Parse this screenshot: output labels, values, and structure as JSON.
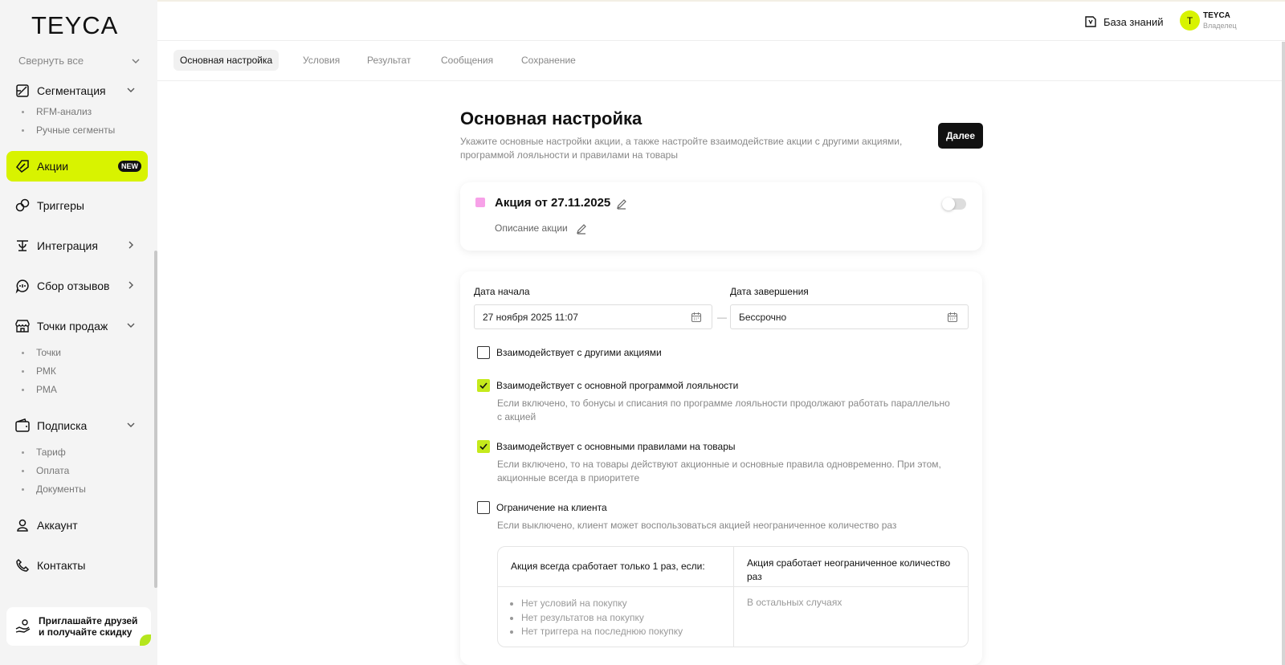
{
  "brand": {
    "logo": "TEYCA",
    "accent": "#d8f300"
  },
  "sidebar": {
    "collapse_all": "Свернуть все",
    "items": {
      "segmentation": "Сегментация",
      "rfm": "RFM-анализ",
      "manual_segments": "Ручные сегменты",
      "promotions": "Акции",
      "promotions_badge": "NEW",
      "triggers": "Триггеры",
      "integration": "Интеграция",
      "reviews": "Сбор отзывов",
      "sales_points": "Точки продаж",
      "points": "Точки",
      "rmk": "РМК",
      "rma": "РМА",
      "subscription": "Подписка",
      "tariff": "Тариф",
      "payment": "Оплата",
      "documents": "Документы",
      "account": "Аккаунт",
      "contacts": "Контакты"
    },
    "invite_line1": "Приглашайте друзей",
    "invite_line2": "и получайте скидку"
  },
  "header": {
    "knowledge_base": "База знаний",
    "user_initial": "T",
    "user_name": "TEYCA",
    "user_role": "Владелец"
  },
  "tabs": [
    "Основная настройка",
    "Условия",
    "Результат",
    "Сообщения",
    "Сохранение"
  ],
  "main": {
    "title": "Основная настройка",
    "subtitle": "Укажите основные настройки акции, а также настройте взаимодействие акции с другими акциями, программой лояльности и правилами на товары",
    "next_button": "Далее",
    "promo_name": "Акция от 27.11.2025",
    "promo_description": "Описание акции",
    "promo_color": "#f7a1e8",
    "promo_enabled": false,
    "start_label": "Дата начала",
    "start_value": "27 ноября 2025 11:07",
    "end_label": "Дата завершения",
    "end_value": "Бессрочно",
    "dash": "—",
    "options": {
      "other_promos": {
        "label": "Взаимодействует с другими акциями",
        "checked": false
      },
      "loyalty": {
        "label": "Взаимодействует с основной программой лояльности",
        "checked": true,
        "hint": "Если включено, то бонусы и списания по программе лояльности продолжают работать параллельно с акцией"
      },
      "product_rules": {
        "label": "Взаимодействует с основными правилами на товары",
        "checked": true,
        "hint": "Если включено, то на товары действуют акционные и основные правила одновременно. При этом, акционные всегда в приоритете"
      },
      "client_limit": {
        "label": "Ограничение на клиента",
        "checked": false,
        "hint": "Если выключено, клиент может воспользоваться акцией неограниченное количество раз"
      }
    },
    "table": {
      "col1_header": "Акция всегда сработает только 1 раз, если:",
      "col1_items": [
        "Нет условий на покупку",
        "Нет результатов на покупку",
        "Нет триггера на последнюю покупку"
      ],
      "col2_header": "Акция сработает неограниченное количество раз",
      "col2_text": "В остальных случаях"
    }
  }
}
